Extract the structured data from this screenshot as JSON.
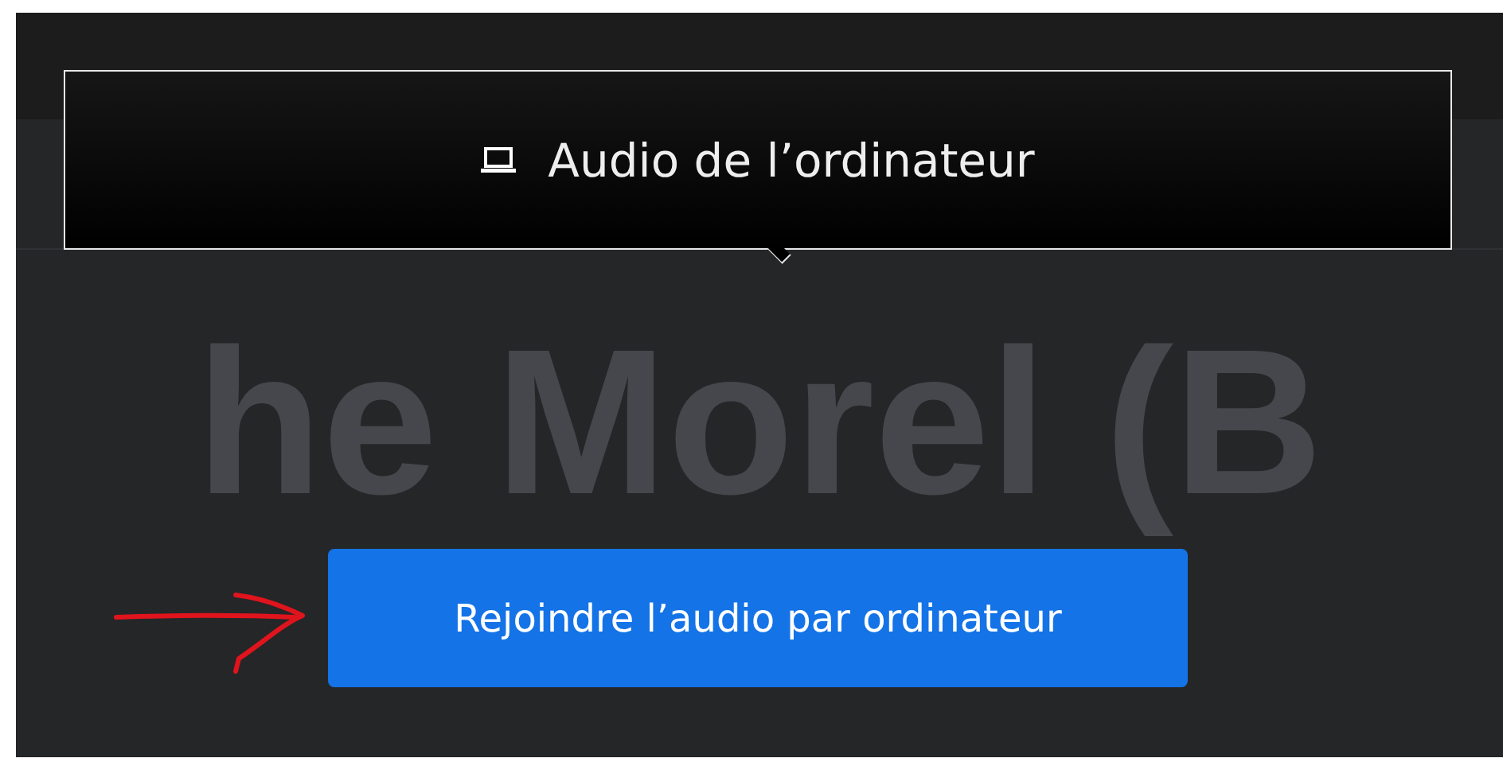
{
  "tooltip": {
    "label": "Audio de l’ordinateur"
  },
  "participant_name": "he Morel (B",
  "join_button": {
    "label": "Rejoindre l’audio par ordinateur"
  },
  "annotation": {
    "kind": "arrow",
    "color": "#e0141c"
  }
}
